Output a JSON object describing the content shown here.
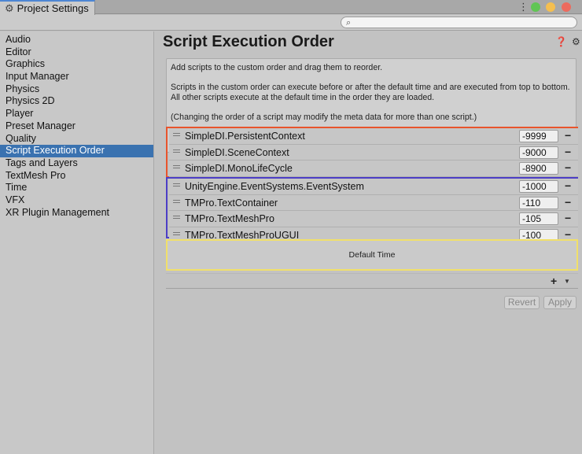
{
  "window": {
    "tab_title": "Project Settings",
    "tab_icon": "gear-icon"
  },
  "toolbar": {
    "search_placeholder": ""
  },
  "sidebar": {
    "items": [
      {
        "label": "Audio"
      },
      {
        "label": "Editor"
      },
      {
        "label": "Graphics"
      },
      {
        "label": "Input Manager"
      },
      {
        "label": "Physics"
      },
      {
        "label": "Physics 2D"
      },
      {
        "label": "Player"
      },
      {
        "label": "Preset Manager"
      },
      {
        "label": "Quality"
      },
      {
        "label": "Script Execution Order",
        "selected": true
      },
      {
        "label": "Tags and Layers"
      },
      {
        "label": "TextMesh Pro"
      },
      {
        "label": "Time"
      },
      {
        "label": "VFX"
      },
      {
        "label": "XR Plugin Management"
      }
    ]
  },
  "main": {
    "title": "Script Execution Order",
    "help": {
      "p1": "Add scripts to the custom order and drag them to reorder.",
      "p2": "Scripts in the custom order can execute before or after the default time and are executed from top to bottom. All other scripts execute at the default time in the order they are loaded.",
      "p3": "(Changing the order of a script may modify the meta data for more than one script.)"
    },
    "scripts": [
      {
        "name": "SimpleDI.PersistentContext",
        "order": "-9999"
      },
      {
        "name": "SimpleDI.SceneContext",
        "order": "-9000"
      },
      {
        "name": "SimpleDI.MonoLifeCycle",
        "order": "-8900"
      },
      {
        "name": "UnityEngine.EventSystems.EventSystem",
        "order": "-1000"
      },
      {
        "name": "TMPro.TextContainer",
        "order": "-110"
      },
      {
        "name": "TMPro.TextMeshPro",
        "order": "-105"
      },
      {
        "name": "TMPro.TextMeshProUGUI",
        "order": "-100"
      }
    ],
    "default_time_label": "Default Time",
    "add_label": "+",
    "remove_label": "−",
    "revert_label": "Revert",
    "apply_label": "Apply"
  },
  "colors": {
    "selection": "#3a72b0",
    "group_red": "#e8542c",
    "group_blue": "#4c3ec6",
    "default_time_border": "#f1e06a"
  }
}
